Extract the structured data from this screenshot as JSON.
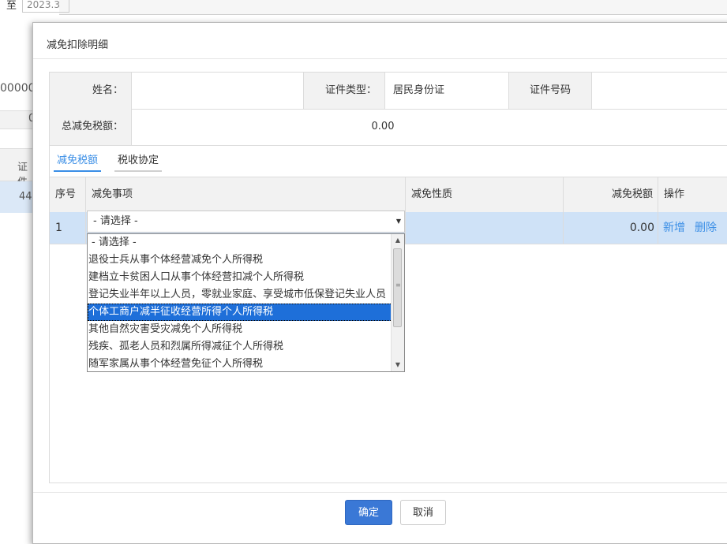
{
  "background": {
    "label_start": "至",
    "date_value": "2023.3",
    "partial_number": "00000",
    "partial_zero": "0",
    "partial_header": "证件",
    "partial_cell": "44"
  },
  "dialog": {
    "title": "减免扣除明细",
    "info": {
      "name_label": "姓名：",
      "name_value": "",
      "id_type_label": "证件类型：",
      "id_type_value": "居民身份证",
      "id_number_label": "证件号码",
      "id_number_value": "",
      "total_label": "总减免税额：",
      "total_value": "0.00"
    },
    "tabs": [
      {
        "label": "减免税额",
        "active": true
      },
      {
        "label": "税收协定",
        "active": false
      }
    ],
    "table": {
      "headers": [
        "序号",
        "减免事项",
        "减免性质",
        "减免税额",
        "操作"
      ],
      "rows": [
        {
          "index": "1",
          "item": "- 请选择 -",
          "nature": "",
          "amount": "0.00",
          "actions": [
            "新增",
            "删除"
          ]
        }
      ]
    },
    "select": {
      "value": "- 请选择 -",
      "options": [
        "- 请选择 -",
        "退役士兵从事个体经营减免个人所得税",
        "建档立卡贫困人口从事个体经营扣减个人所得税",
        "登记失业半年以上人员，零就业家庭、享受城市低保登记失业人员",
        "个体工商户减半征收经营所得个人所得税",
        "其他自然灾害受灾减免个人所得税",
        "残疾、孤老人员和烈属所得减征个人所得税",
        "随军家属从事个体经营免征个人所得税"
      ],
      "highlighted": "个体工商户减半征收经营所得个人所得税"
    },
    "buttons": {
      "confirm": "确定",
      "cancel": "取消"
    }
  },
  "colors": {
    "accent": "#3a8ee6",
    "primary_button": "#3a78d6",
    "row_highlight": "#cfe2f7",
    "option_selected": "#1e6fd9"
  }
}
